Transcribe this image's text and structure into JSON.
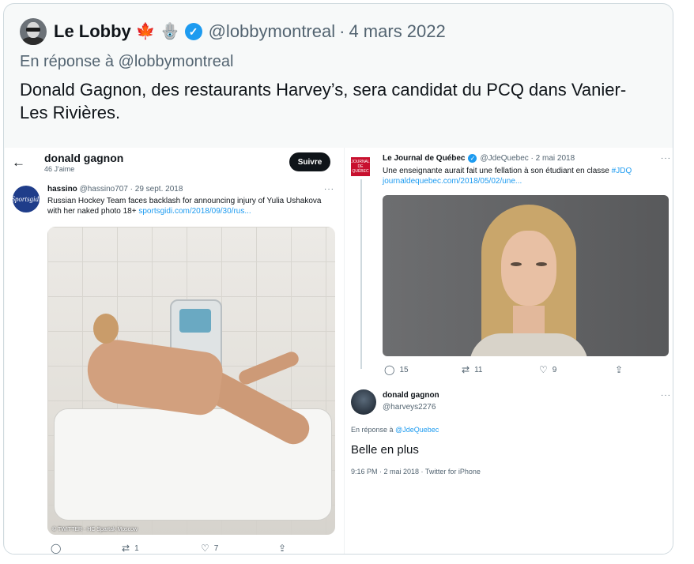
{
  "tweet": {
    "display_name": "Le Lobby",
    "emoji_1": "🍁",
    "emoji_2": "🪬",
    "handle": "@lobbymontreal",
    "separator": "·",
    "date": "4 mars 2022",
    "reply_prefix": "En réponse à",
    "reply_to": "@lobbymontreal",
    "text": "Donald Gagnon, des restaurants Harvey’s, sera candidat du PCQ dans Vanier-Les Rivières."
  },
  "left_shot": {
    "back_icon": "←",
    "profile_name": "donald gagnon",
    "profile_likes": "46 J'aime",
    "follow_label": "Suivre",
    "avatar_text": "Sportsgidi",
    "author_name": "hassino",
    "author_handle": "@hassino707 · 29 sept. 2018",
    "more": "···",
    "text": "Russian Hockey Team faces backlash for announcing injury of Yulia Ushakova with her naked photo 18+",
    "url": "sportsgidi.com/2018/09/30/rus...",
    "watermark": "© TWITTER - HC Spartak Moscow",
    "actions": {
      "reply_icon": "◯",
      "retweet_icon": "⇄",
      "retweets": "1",
      "like_icon": "♡",
      "likes": "7",
      "share_icon": "⇪"
    }
  },
  "right_shot": {
    "avatar_text": "JOURNAL DE QUÉBEC",
    "author_name": "Le Journal de Québec",
    "verified_icon": "✓",
    "author_handle": "@JdeQuebec · 2 mai 2018",
    "more": "···",
    "text": "Une enseignante aurait fait une fellation à son étudiant en classe",
    "hashtag": "#JDQ",
    "url": "journaldequebec.com/2018/05/02/une...",
    "actions": {
      "reply_icon": "◯",
      "replies": "15",
      "retweet_icon": "⇄",
      "retweets": "11",
      "like_icon": "♡",
      "likes": "9",
      "share_icon": "⇪"
    },
    "reply_name": "donald gagnon",
    "reply_handle": "@harveys2276",
    "reply_prefix": "En réponse à",
    "reply_to": "@JdeQuebec",
    "reply_text": "Belle en plus",
    "reply_meta": "9:16 PM · 2 mai 2018 · Twitter for iPhone"
  },
  "colors": {
    "accent": "#1d9bf0",
    "text": "#0f1419",
    "muted": "#536471",
    "card_bg": "#f7f9f9"
  }
}
